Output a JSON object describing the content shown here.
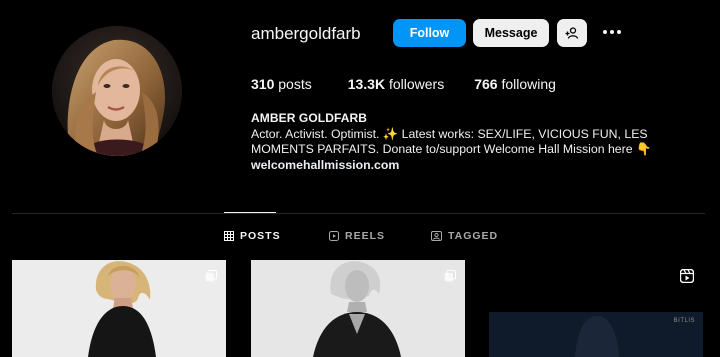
{
  "profile": {
    "username": "ambergoldfarb",
    "avatar_icon": "profile-photo"
  },
  "actions": {
    "follow_label": "Follow",
    "message_label": "Message",
    "add_user_icon": "person-add-icon",
    "more_icon": "more-horizontal-icon",
    "follow_color": "#0095f6"
  },
  "stats": {
    "posts_count": "310",
    "posts_label": "posts",
    "followers_count": "13.3K",
    "followers_label": "followers",
    "following_count": "766",
    "following_label": "following"
  },
  "bio": {
    "name": "AMBER GOLDFARB",
    "text": "Actor. Activist. Optimist. ✨ Latest works: SEX/LIFE, VICIOUS FUN, LES MOMENTS PARFAITS. Donate to/support Welcome Hall Mission here 👇",
    "link": "welcomehallmission.com"
  },
  "tabs": [
    {
      "label": "POSTS",
      "icon": "grid-icon",
      "active": true
    },
    {
      "label": "REELS",
      "icon": "reels-icon",
      "active": false
    },
    {
      "label": "TAGGED",
      "icon": "tagged-icon",
      "active": false
    }
  ],
  "grid": [
    {
      "badge_icon": "clip-icon",
      "caption": ""
    },
    {
      "badge_icon": "clip-icon",
      "caption": ""
    },
    {
      "badge_icon": "reel-icon",
      "caption": "BITLIS"
    }
  ]
}
